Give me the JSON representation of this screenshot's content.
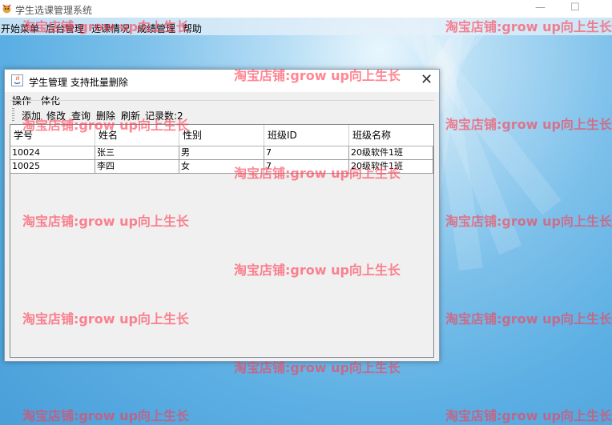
{
  "window": {
    "title": "学生选课管理系统",
    "minimize": "—",
    "maximize": "☐"
  },
  "menu": [
    "开始菜单",
    "后台管理",
    "选课情况",
    "成绩管理",
    "帮助"
  ],
  "dialog": {
    "title": "学生管理  支持批量删除",
    "close": "✕",
    "group_label": "操作一体化",
    "toolbar": {
      "add": "添加",
      "edit": "修改",
      "query": "查询",
      "delete": "删除",
      "refresh": "刷新",
      "count": "记录数:2"
    },
    "table": {
      "columns": [
        "学号",
        "姓名",
        "性别",
        "班级ID",
        "班级名称"
      ],
      "rows": [
        [
          "10024",
          "张三",
          "男",
          "7",
          "20级软件1班"
        ],
        [
          "10025",
          "李四",
          "女",
          "7",
          "20级软件1班"
        ]
      ]
    }
  },
  "watermark": "淘宝店铺:grow up向上生长",
  "colors": {
    "watermark": "#ff3c50",
    "border": "#7f9db9"
  }
}
